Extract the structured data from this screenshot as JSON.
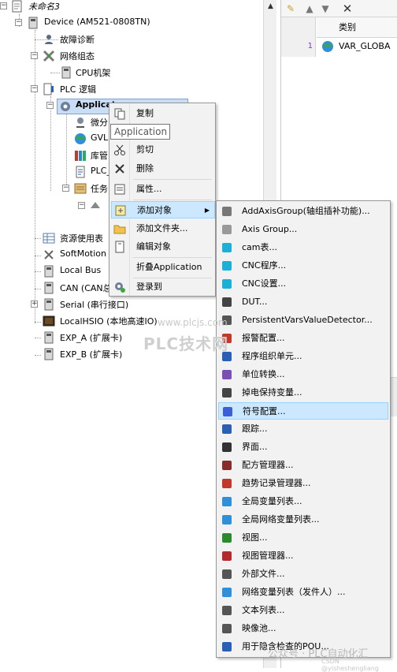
{
  "tree": {
    "root": "未命名3",
    "device": "Device (AM521-0808TN)",
    "fault_diag": "故障诊断",
    "network_config": "网络组态",
    "cpu_rack": "CPU机架",
    "plc_logic": "PLC 逻辑",
    "application": "Applicat",
    "micro": "微分",
    "gvl": "GVL",
    "lib": "库管",
    "plc_prg": "PLC_",
    "task": "任务",
    "resource": "资源使用表",
    "softmotion": "SoftMotion G",
    "localbus": "Local Bus",
    "can": "CAN (CAN总",
    "serial": "Serial (串行接口)",
    "localhsio": "LocalHSIO (本地高速IO)",
    "exp_a": "EXP_A (扩展卡)",
    "exp_b": "EXP_B (扩展卡)"
  },
  "right_panel": {
    "column_header": "类别",
    "row_number": "1",
    "row_value": "VAR_GLOBA"
  },
  "tooltip": "Application",
  "context_menu": {
    "copy": "复制",
    "cut": "剪切",
    "delete": "删除",
    "properties": "属性...",
    "add_object": "添加对象",
    "add_folder": "添加文件夹...",
    "edit_object": "编辑对象",
    "collapse": "折叠Application",
    "login": "登录到"
  },
  "submenu": [
    {
      "label": "AddAxisGroup(轴组插补功能)...",
      "icon": "axis-group-add-icon"
    },
    {
      "label": "Axis Group...",
      "icon": "axis-group-icon"
    },
    {
      "label": "cam表...",
      "icon": "cam-table-icon"
    },
    {
      "label": "CNC程序...",
      "icon": "cnc-program-icon"
    },
    {
      "label": "CNC设置...",
      "icon": "cnc-settings-icon"
    },
    {
      "label": "DUT...",
      "icon": "dut-icon"
    },
    {
      "label": "PersistentVarsValueDetector...",
      "icon": "persistent-detector-icon"
    },
    {
      "label": "报警配置...",
      "icon": "alarm-config-icon"
    },
    {
      "label": "程序组织单元...",
      "icon": "pou-icon"
    },
    {
      "label": "单位转换...",
      "icon": "unit-conversion-icon"
    },
    {
      "label": "掉电保持变量...",
      "icon": "retain-vars-icon"
    },
    {
      "label": "符号配置...",
      "icon": "symbol-config-icon"
    },
    {
      "label": "跟踪...",
      "icon": "trace-icon"
    },
    {
      "label": "界面...",
      "icon": "interface-icon"
    },
    {
      "label": "配方管理器...",
      "icon": "recipe-manager-icon"
    },
    {
      "label": "趋势记录管理器...",
      "icon": "trend-manager-icon"
    },
    {
      "label": "全局变量列表...",
      "icon": "global-var-list-icon"
    },
    {
      "label": "全局网络变量列表...",
      "icon": "global-net-var-list-icon"
    },
    {
      "label": "视图...",
      "icon": "visualization-icon"
    },
    {
      "label": "视图管理器...",
      "icon": "visualization-manager-icon"
    },
    {
      "label": "外部文件...",
      "icon": "external-file-icon"
    },
    {
      "label": "网络变量列表（发件人）...",
      "icon": "net-var-list-sender-icon"
    },
    {
      "label": "文本列表...",
      "icon": "text-list-icon"
    },
    {
      "label": "映像池...",
      "icon": "image-pool-icon"
    },
    {
      "label": "用于隐含检查的POU...",
      "icon": "implicit-check-pou-icon"
    }
  ],
  "watermarks": {
    "url": "www.plcjs.com",
    "site": "PLC技术网",
    "account": "公众号 · PLC自动化汇",
    "csdn": "CSDN @yisheshengliang"
  }
}
